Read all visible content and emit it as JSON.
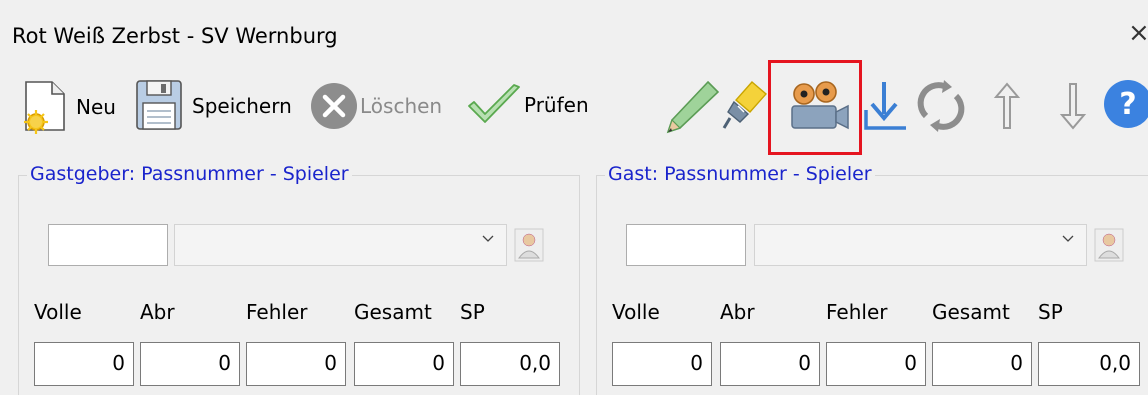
{
  "window": {
    "title": "Rot Weiß Zerbst - SV Wernburg",
    "close_glyph": "×"
  },
  "toolbar": {
    "new_label": "Neu",
    "save_label": "Speichern",
    "delete_label": "Löschen",
    "check_label": "Prüfen",
    "icons": [
      "new-document-icon",
      "save-disk-icon",
      "delete-circle-icon",
      "check-icon",
      "pencil-icon",
      "plug-icon",
      "video-camera-icon",
      "download-arrow-icon",
      "refresh-icon",
      "arrow-up-icon",
      "arrow-down-icon",
      "help-icon"
    ],
    "help_glyph": "?"
  },
  "home": {
    "group_title": "Gastgeber: Passnummer - Spieler",
    "pass_number": "",
    "player_selected": "",
    "columns": [
      "Volle",
      "Abr",
      "Fehler",
      "Gesamt",
      "SP"
    ],
    "values": [
      "0",
      "0",
      "0",
      "0",
      "0,0"
    ]
  },
  "guest": {
    "group_title": "Gast: Passnummer - Spieler",
    "pass_number": "",
    "player_selected": "",
    "columns": [
      "Volle",
      "Abr",
      "Fehler",
      "Gesamt",
      "SP"
    ],
    "values": [
      "0",
      "0",
      "0",
      "0",
      "0,0"
    ]
  },
  "colors": {
    "accent_blue": "#1a24cc",
    "highlight_red": "#e5141f",
    "help_blue": "#3b82e0"
  }
}
